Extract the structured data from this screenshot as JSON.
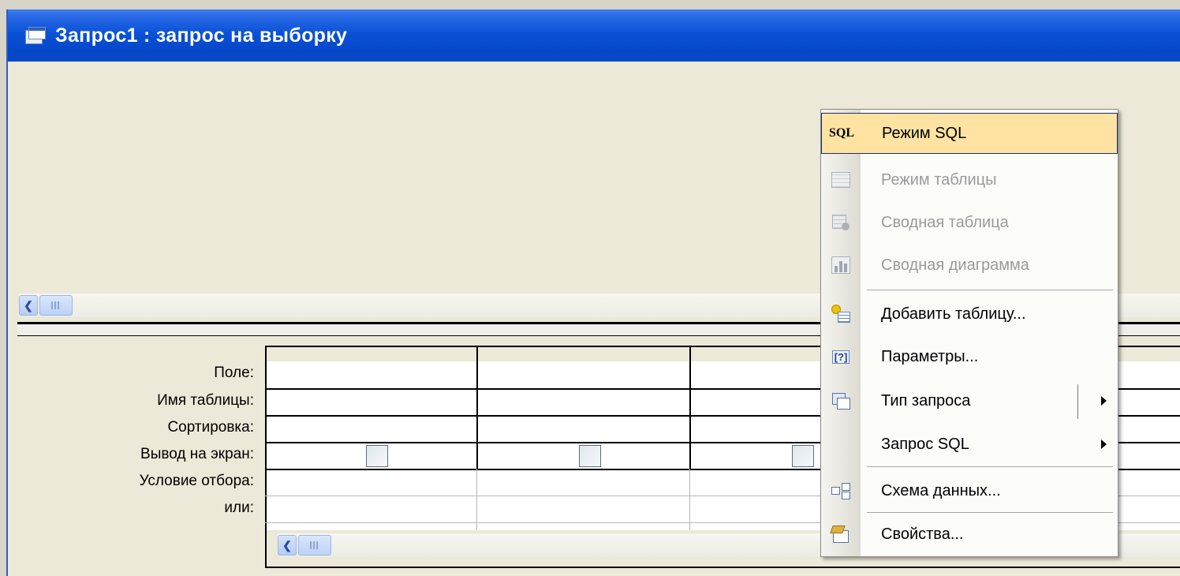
{
  "window": {
    "title": "Запрос1 : запрос на выборку"
  },
  "design_grid": {
    "row_labels": [
      "Поле:",
      "Имя таблицы:",
      "Сортировка:",
      "Вывод на экран:",
      "Условие отбора:",
      "или:"
    ],
    "show_checkboxes_visible": 3
  },
  "context_menu": {
    "items": [
      {
        "label": "Режим SQL",
        "icon": "sql-icon",
        "icon_text": "SQL",
        "state": "highlighted"
      },
      {
        "label": "Режим таблицы",
        "icon": "datasheet-icon",
        "state": "disabled"
      },
      {
        "label": "Сводная таблица",
        "icon": "pivot-table-icon",
        "state": "disabled"
      },
      {
        "label": "Сводная диаграмма",
        "icon": "pivot-chart-icon",
        "state": "disabled"
      },
      {
        "label": "Добавить таблицу...",
        "icon": "add-table-icon",
        "state": "enabled"
      },
      {
        "label": "Параметры...",
        "icon": "parameters-icon",
        "icon_text": "[?]",
        "state": "enabled"
      },
      {
        "label": "Тип запроса",
        "icon": "query-type-icon",
        "state": "enabled",
        "submenu": true
      },
      {
        "label": "Запрос SQL",
        "icon": "",
        "state": "enabled",
        "submenu": true
      },
      {
        "label": "Схема данных...",
        "icon": "relationships-icon",
        "state": "enabled"
      },
      {
        "label": "Свойства...",
        "icon": "properties-icon",
        "state": "enabled"
      }
    ]
  },
  "colors": {
    "titlebar": "#0a52d8",
    "menu_highlight": "#ffe3a3",
    "window_bg": "#ece9d8"
  }
}
